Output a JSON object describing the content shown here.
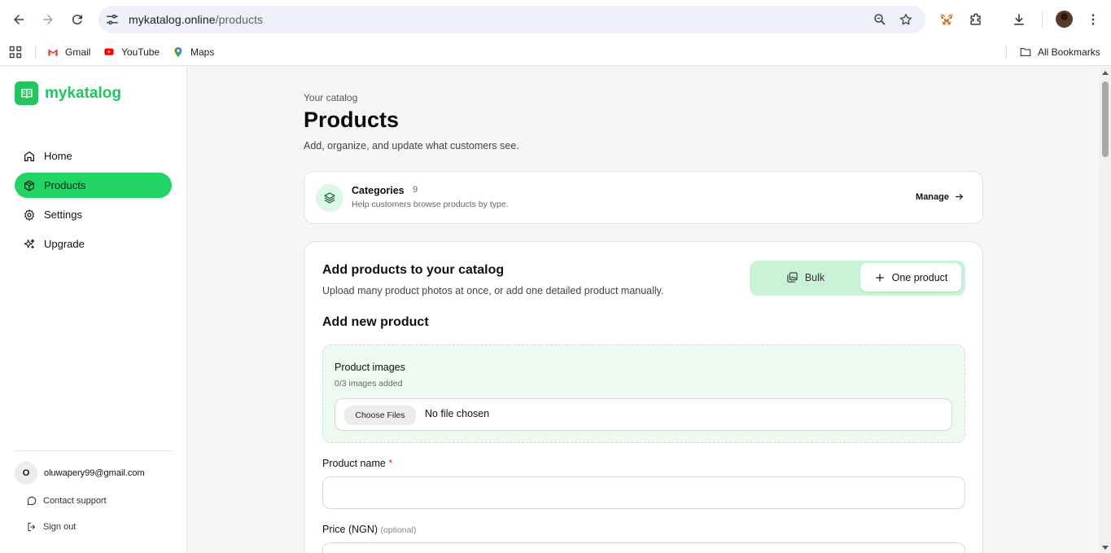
{
  "browser": {
    "url_host": "mykatalog.online",
    "url_path": "/products",
    "bookmarks": [
      {
        "label": "Gmail",
        "icon": "gmail-icon"
      },
      {
        "label": "YouTube",
        "icon": "youtube-icon"
      },
      {
        "label": "Maps",
        "icon": "maps-icon"
      }
    ],
    "all_bookmarks_label": "All Bookmarks"
  },
  "brand": {
    "name": "mykatalog",
    "color": "#22c55e"
  },
  "sidebar": {
    "items": [
      {
        "label": "Home",
        "icon": "home-icon",
        "active": false
      },
      {
        "label": "Products",
        "icon": "box-icon",
        "active": true
      },
      {
        "label": "Settings",
        "icon": "gear-icon",
        "active": false
      },
      {
        "label": "Upgrade",
        "icon": "sparkles-icon",
        "active": false
      }
    ],
    "user_initial": "O",
    "user_email": "oluwapery99@gmail.com",
    "contact_support": "Contact support",
    "sign_out": "Sign out"
  },
  "header": {
    "eyebrow": "Your catalog",
    "title": "Products",
    "subtitle": "Add, organize, and update what customers see."
  },
  "categories": {
    "title": "Categories",
    "count": "9",
    "description": "Help customers browse products by type.",
    "manage_label": "Manage"
  },
  "add_products": {
    "title": "Add products to your catalog",
    "subtitle": "Upload many product photos at once, or add one detailed product manually.",
    "bulk_label": "Bulk",
    "one_product_label": "One product",
    "section_title": "Add new product",
    "images_label": "Product images",
    "images_count": "0/3 images added",
    "choose_files": "Choose Files",
    "no_file": "No file chosen",
    "product_name_label": "Product name",
    "required_mark": "*",
    "price_label": "Price (NGN)",
    "price_optional": "(optional)"
  }
}
